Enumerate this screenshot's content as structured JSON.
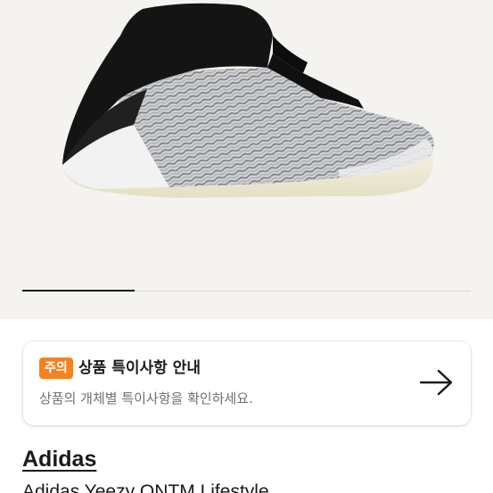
{
  "notice": {
    "badge": "주의",
    "title": "상품 특이사항 안내",
    "description": "상품의 개체별 특이사항을 확인하세요."
  },
  "product": {
    "brand": "Adidas",
    "name": "Adidas Yeezy QNTM Lifestyle"
  },
  "carousel": {
    "active_index": 0,
    "total": 4
  },
  "colors": {
    "accent": "#f58220",
    "hero_background": "#f4f3ef"
  }
}
